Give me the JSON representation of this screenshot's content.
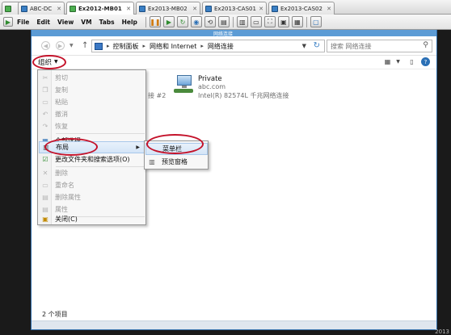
{
  "vm_tabs": [
    {
      "label": "ABC-DC",
      "active": false,
      "running": false
    },
    {
      "label": "Ex2012-MB01",
      "active": true,
      "running": true
    },
    {
      "label": "Ex2013-MB02",
      "active": false,
      "running": false
    },
    {
      "label": "Ex2013-CAS01",
      "active": false,
      "running": false
    },
    {
      "label": "Ex2013-CAS02",
      "active": false,
      "running": false
    }
  ],
  "vm_menu": [
    "File",
    "Edit",
    "View",
    "VM",
    "Tabs",
    "Help"
  ],
  "explorer": {
    "title": "网络连接",
    "breadcrumb": [
      "控制面板",
      "网络和 Internet",
      "网络连接"
    ],
    "search_placeholder": "搜索 网络连接",
    "organize_label": "组织",
    "status_text": "2 个项目"
  },
  "adapter": {
    "name": "Private",
    "domain": "abc.com",
    "device": "Intel(R) 82574L 千兆网络连接",
    "partial_left": "接 #2"
  },
  "organize_menu": [
    {
      "label": "剪切",
      "icon": "cut-icon",
      "disabled": true
    },
    {
      "label": "复制",
      "icon": "copy-icon",
      "disabled": true
    },
    {
      "label": "粘贴",
      "icon": "paste-icon",
      "disabled": true
    },
    {
      "label": "撤消",
      "icon": "undo-icon",
      "disabled": true
    },
    {
      "label": "恢复",
      "icon": "redo-icon",
      "disabled": true
    },
    {
      "label": "全部选择",
      "icon": "select-all-icon",
      "disabled": false
    },
    {
      "label": "布局",
      "icon": "layout-icon",
      "disabled": false,
      "submenu": true
    },
    {
      "label": "更改文件夹和搜索选项(O)",
      "icon": "folder-options-icon",
      "disabled": false
    },
    {
      "label": "删除",
      "icon": "delete-icon",
      "disabled": true
    },
    {
      "label": "重命名",
      "icon": "rename-icon",
      "disabled": true
    },
    {
      "label": "删除属性",
      "icon": "remove-properties-icon",
      "disabled": true
    },
    {
      "label": "属性",
      "icon": "properties-icon",
      "disabled": true
    },
    {
      "label": "关闭(C)",
      "icon": "close-icon",
      "disabled": false
    }
  ],
  "layout_submenu": [
    {
      "label": "菜单栏",
      "icon": "menu-bar-icon"
    },
    {
      "label": "预览窗格",
      "icon": "preview-pane-icon"
    }
  ],
  "corner_text": "2013"
}
